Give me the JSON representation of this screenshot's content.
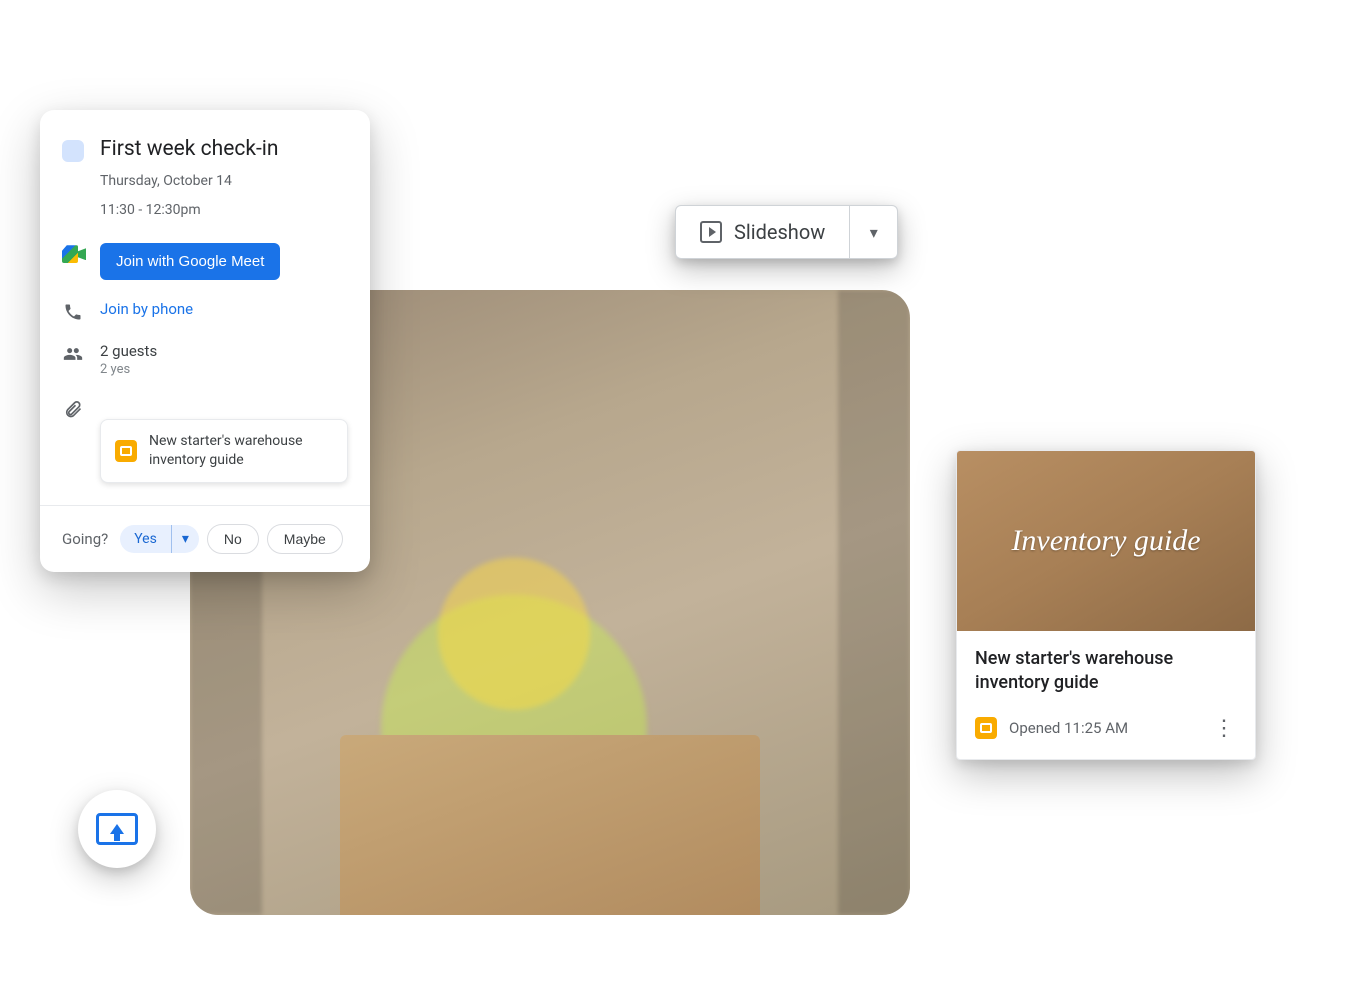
{
  "event": {
    "title": "First week check-in",
    "date": "Thursday, October 14",
    "time": "11:30 - 12:30pm",
    "meet_button": "Join with Google Meet",
    "phone_link": "Join by phone",
    "guests_count": "2 guests",
    "guests_yes": "2 yes",
    "attachment_name": "New starter's warehouse inventory guide",
    "going_label": "Going?",
    "rsvp_yes": "Yes",
    "rsvp_no": "No",
    "rsvp_maybe": "Maybe"
  },
  "slideshow": {
    "label": "Slideshow"
  },
  "file_card": {
    "thumb_text": "Inventory guide",
    "title": "New starter's warehouse inventory guide",
    "opened": "Opened 11:25 AM"
  }
}
